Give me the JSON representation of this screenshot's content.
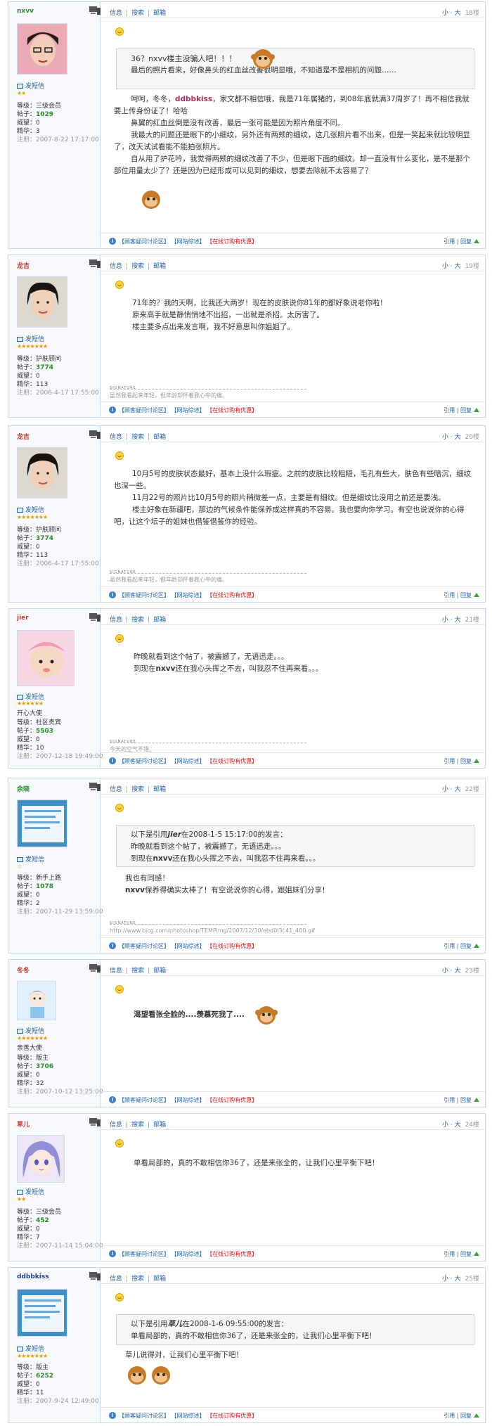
{
  "toolbar": {
    "info": "信息",
    "search": "搜索",
    "mail": "邮箱",
    "small": "小",
    "big": "大"
  },
  "footer": {
    "link1": "【顾客疑问讨论区】",
    "link2": "【网站综述】",
    "link3": "【在线订购有优惠】",
    "quote": "引用",
    "reply": "回复"
  },
  "labels": {
    "send_msg": "发短信",
    "posts": "帖子：",
    "prestige": "威望：",
    "essence": "精华：",
    "registered": "注册：",
    "rank": "等级：",
    "signature": "SIGNATURE"
  },
  "posts": [
    {
      "user": "nxvv",
      "floor": "18楼",
      "stars": "★★",
      "rank": "三级会员",
      "posts": "1029",
      "prestige": "0",
      "essence": "3",
      "reg": "2007-8-22 17:17:00",
      "quote_line1": "36？nxvv楼主没骗人吧！！！",
      "quote_line2": "最后的照片看来，好像鼻头的红血丝改善很明显哦，不知道是不是相机的问题……",
      "body1_pre": "呵呵，冬冬，",
      "body1_name": "ddbbkiss",
      "body1_post": "，家文都不相信哦，我是71年属猪的，到08年底就满37周岁了！再不相信我就要上传身份证了！哈哈",
      "body2": "鼻翼的红血丝倒是没有改善，最后一张可能是因为照片角度不同。",
      "body3": "我最大的问题还是眼下的小细纹，另外还有两颊的细纹，这几张照片看不出来，但是一笑起来就比较明显了，改天试试看能不能拍张照片。",
      "body4": "自从用了护花吟，我觉得两颊的细纹改善了不少，但是眼下面的细纹，却一直没有什么变化，是不是那个部位用量太少了？还是因为已经形成可以见到的细纹，想要去除就不太容易了？"
    },
    {
      "user": "龙吉",
      "floor": "19楼",
      "stars": "★★★★★★★",
      "rank": "护肤顾问",
      "posts": "3774",
      "prestige": "0",
      "essence": "113",
      "reg": "2006-4-17 17:55:00",
      "body1": "71年的？我的天啊，比我还大两岁！现在的皮肤说你81年的都好象说老你啦！",
      "body2": "原来高手就是静悄悄地不出招，一出就是杀招。太厉害了。",
      "body3": "楼主要多点出来发言啊，我不好意思叫你姐姐了。",
      "sig": "虽然我看起来年轻，但年龄却怀着我心中的痛。"
    },
    {
      "user": "龙吉",
      "floor": "20楼",
      "stars": "★★★★★★★",
      "rank": "护肤顾问",
      "posts": "3774",
      "prestige": "0",
      "essence": "113",
      "reg": "2006-4-17 17:55:00",
      "body1": "10月5号的皮肤状态最好，基本上没什么瑕疵。之前的皮肤比较粗糙，毛孔有些大，肤色有些暗沉，细纹也深一些。",
      "body2": "11月22号的照片比10月5号的照片稍微差一点，主要是有细纹。但是细纹比没用之前还是要浅。",
      "body3": "楼主好象在新疆吧，那边的气候条件能保养成这样真的不容易。我也要向你学习。有空也说说你的心得吧，让这个坛子的姐妹也借鉴借鉴你的经验。",
      "sig": "虽然我看起来年轻，但年龄却怀着我心中的痛。"
    },
    {
      "user": "jier",
      "floor": "21楼",
      "stars": "★★★★★★",
      "rank": "开心大使",
      "rank_label": "社区贵宾",
      "posts": "5503",
      "prestige": "0",
      "essence": "10",
      "reg": "2007-12-18 19:49:00",
      "body1": "昨晚就看到这个帖了，被震撼了，无语迅走。。。",
      "body2_pre": "到现在",
      "body2_name": "nxvv",
      "body2_post": "还在我心头挥之不去，叫我忍不住再来看。。。",
      "sig": "今天的空气不错。"
    },
    {
      "user": "余晓",
      "floor": "22楼",
      "stars": "☆",
      "rank": "新手上路",
      "posts": "1078",
      "prestige": "0",
      "essence": "2",
      "reg": "2007-11-29 13:59:00",
      "quote_head_pre": "以下是引用",
      "quote_head_name": "jier",
      "quote_head_post": "在2008-1-5 15:17:00的发言：",
      "quote_line1": "昨晚就看到这个帖了，被震撼了，无语迅走。。。",
      "quote_line2_pre": "到现在",
      "quote_line2_name": "nxvv",
      "quote_line2_post": "还在我心头挥之不去，叫我忍不住再来看。。。",
      "body1": "我也有同感！",
      "body2_name": "nxvv",
      "body2_post": "保养得确实太棒了！有空说说你的心得，跟姐妹们分享！",
      "sig": "http://www.bjcg.com/photoshop/TEMPimg/2007/12/30/ebd0l3c41_400.gif"
    },
    {
      "user": "冬冬",
      "floor": "23楼",
      "stars": "★★★★★★★",
      "rank": "亲善大使",
      "rank_label": "版主",
      "posts": "3706",
      "prestige": "0",
      "essence": "32",
      "reg": "2007-10-12 13:25:00",
      "body1": "渴望看张全脸的....羡慕死我了...."
    },
    {
      "user": "草儿",
      "floor": "24楼",
      "stars": "★★",
      "rank": "三级会员",
      "posts": "452",
      "prestige": "0",
      "essence": "7",
      "reg": "2007-11-14 15:04:00",
      "body1": "单看局部的，真的不敢相信你36了，还是来张全的，让我们心里平衡下吧！"
    },
    {
      "user": "ddbbkiss",
      "floor": "25楼",
      "stars": "★★★★★★★",
      "rank": "版主",
      "posts": "6252",
      "prestige": "0",
      "essence": "11",
      "reg": "2007-9-24 12:49:00",
      "quote_head_pre": "以下是引用",
      "quote_head_name": "草儿",
      "quote_head_post": "在2008-1-6 09:55:00的发言：",
      "quote_line1": "单看局部的，真的不敢相信你36了，还是来张全的，让我们心里平衡下吧！",
      "body1": "草儿说得对，让我们心里平衡下吧！"
    }
  ]
}
